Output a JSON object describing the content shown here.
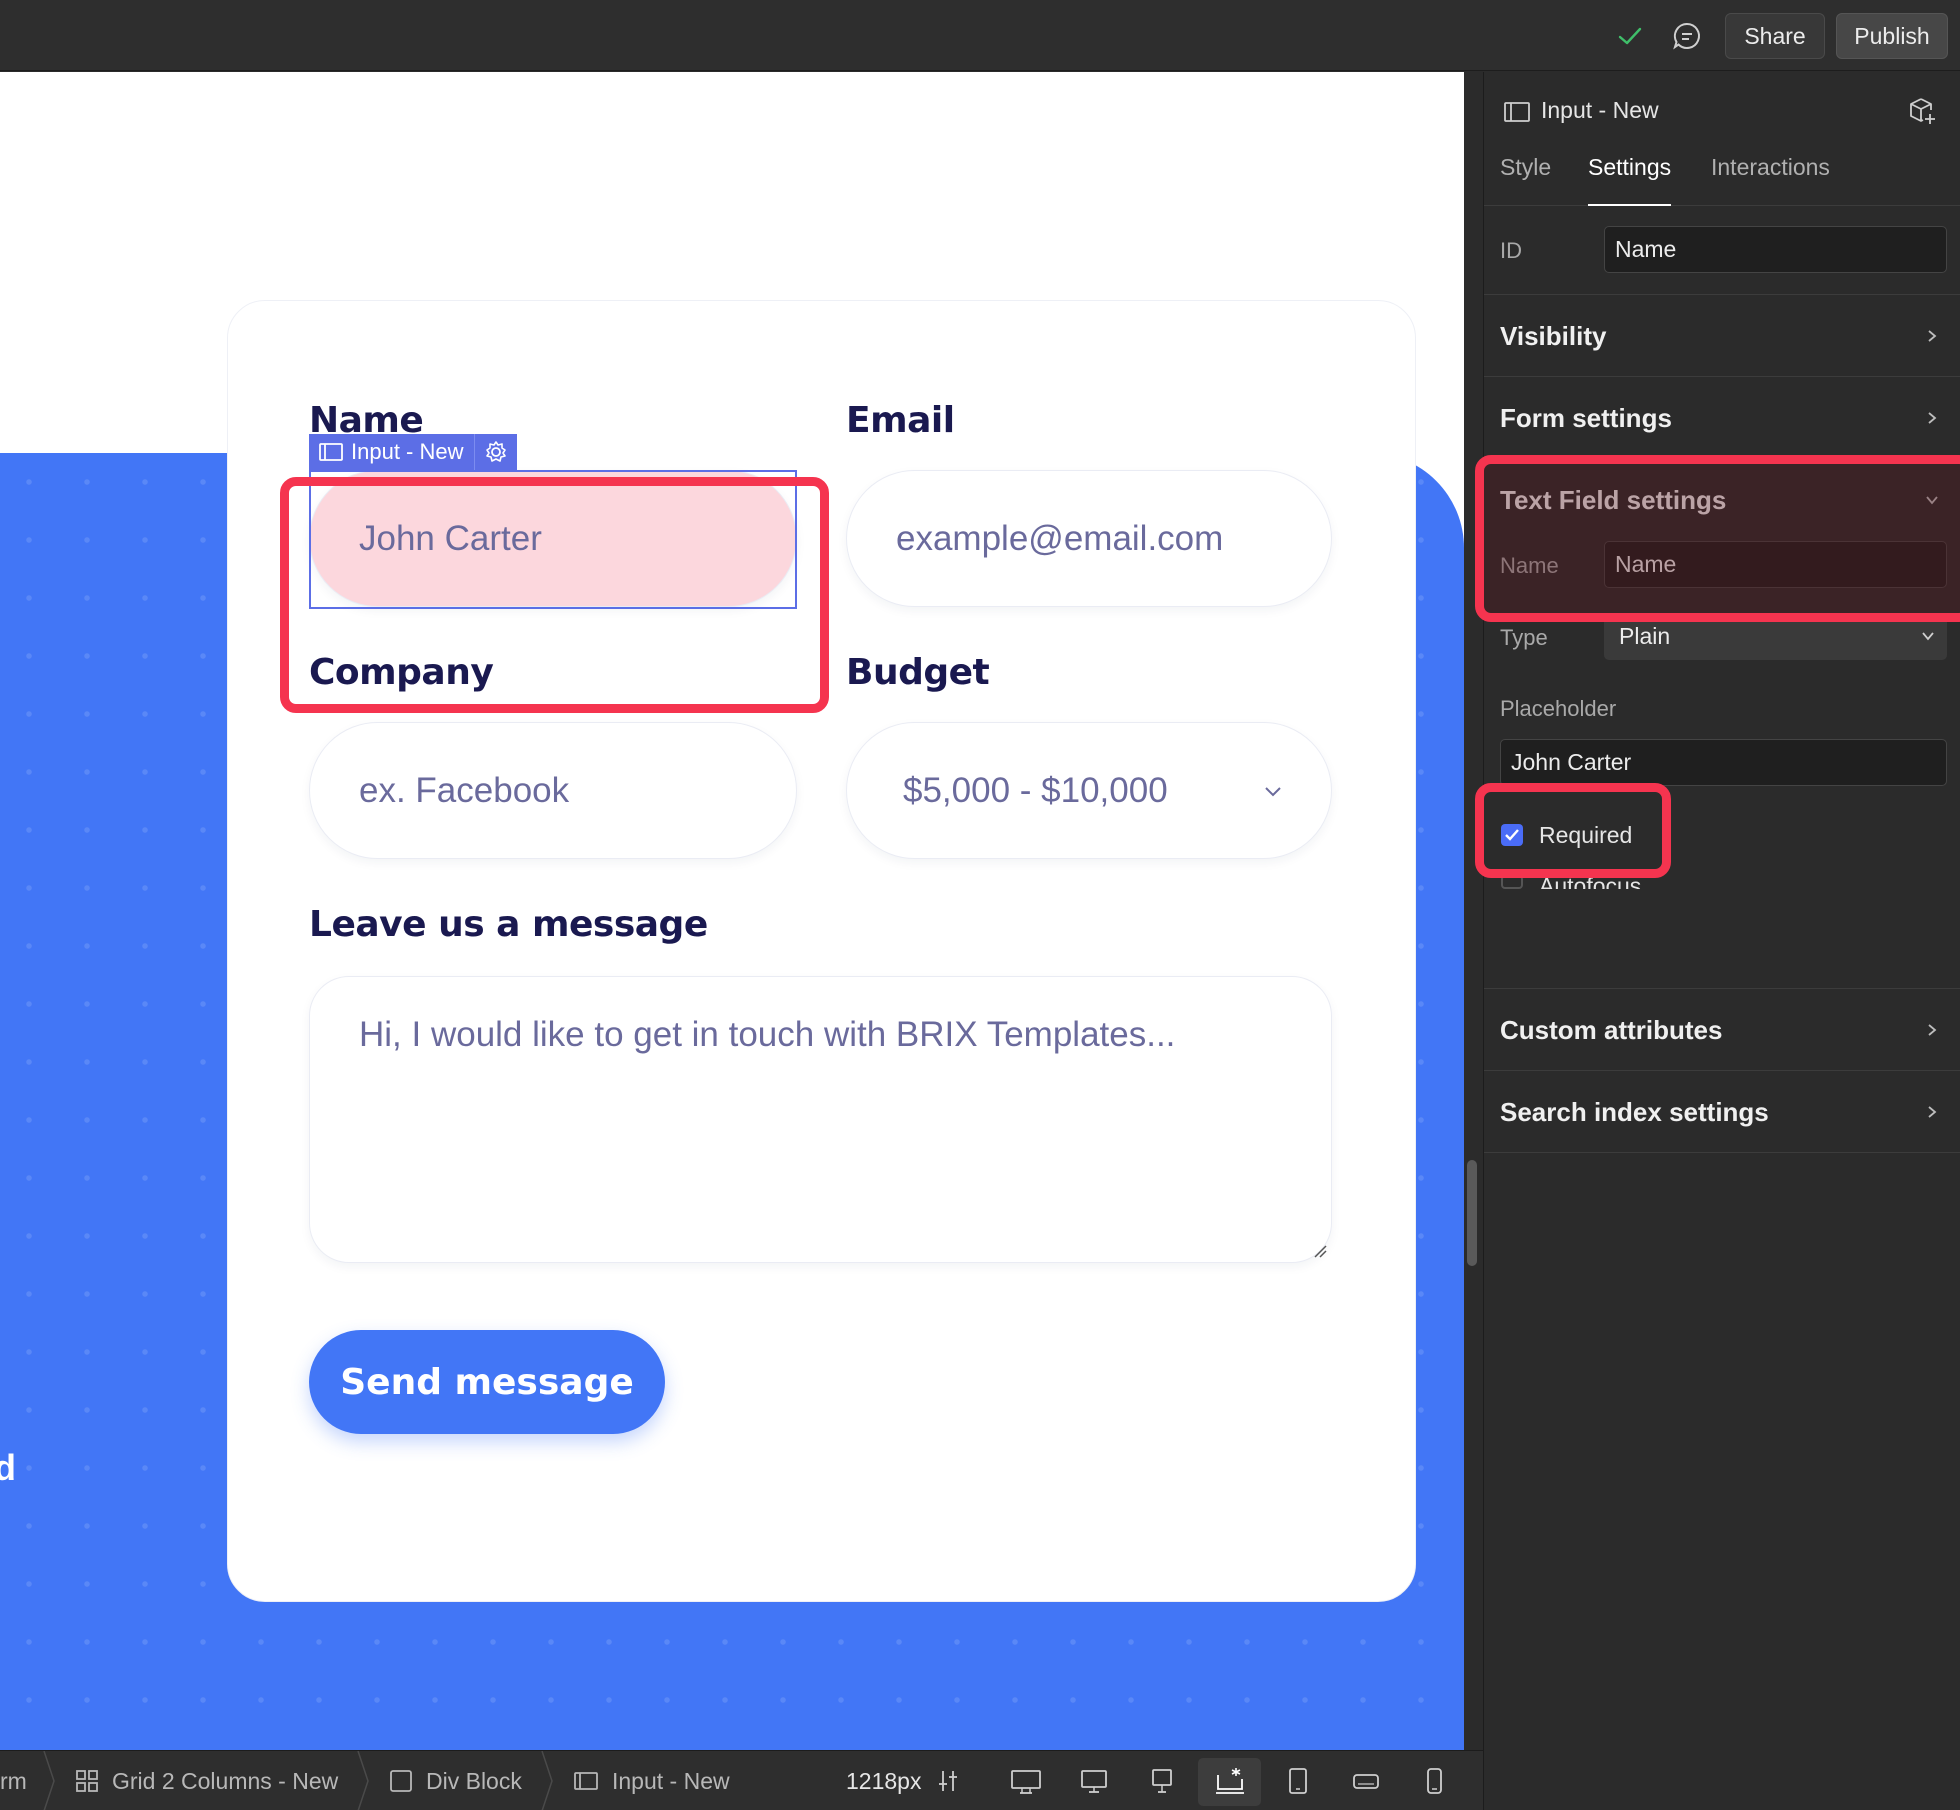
{
  "topbar": {
    "share_label": "Share",
    "publish_label": "Publish"
  },
  "canvas": {
    "edge_text": "d",
    "form": {
      "name_label": "Name",
      "name_placeholder": "John Carter",
      "email_label": "Email",
      "email_placeholder": "example@email.com",
      "company_label": "Company",
      "company_placeholder": "ex. Facebook",
      "budget_label": "Budget",
      "budget_value": "$5,000 - $10,000",
      "message_label": "Leave us a message",
      "message_placeholder": "Hi, I would like to get in touch with BRIX Templates...",
      "send_label": "Send message"
    },
    "selection_tag": "Input - New"
  },
  "panel": {
    "element_title": "Input - New",
    "tabs": [
      "Style",
      "Settings",
      "Interactions"
    ],
    "active_tab": "Settings",
    "id_label": "ID",
    "id_value": "Name",
    "sections": {
      "visibility": "Visibility",
      "form_settings": "Form settings",
      "text_field_settings": "Text Field settings",
      "custom_attributes": "Custom attributes",
      "search_index": "Search index settings"
    },
    "name_label": "Name",
    "name_value": "Name",
    "type_label": "Type",
    "type_value": "Plain",
    "placeholder_label": "Placeholder",
    "placeholder_value": "John Carter",
    "required_label": "Required",
    "required_checked": true,
    "autofocus_label": "Autofocus",
    "autofocus_checked": false
  },
  "bottombar": {
    "crumbs": [
      "rm",
      "Grid 2 Columns - New",
      "Div Block",
      "Input - New"
    ],
    "width_readout": "1218px"
  },
  "colors": {
    "accent_blue": "#4276f6",
    "highlight_red": "#f5344f",
    "selection_purple": "#5c6ee6",
    "navy_text": "#1a1950"
  }
}
